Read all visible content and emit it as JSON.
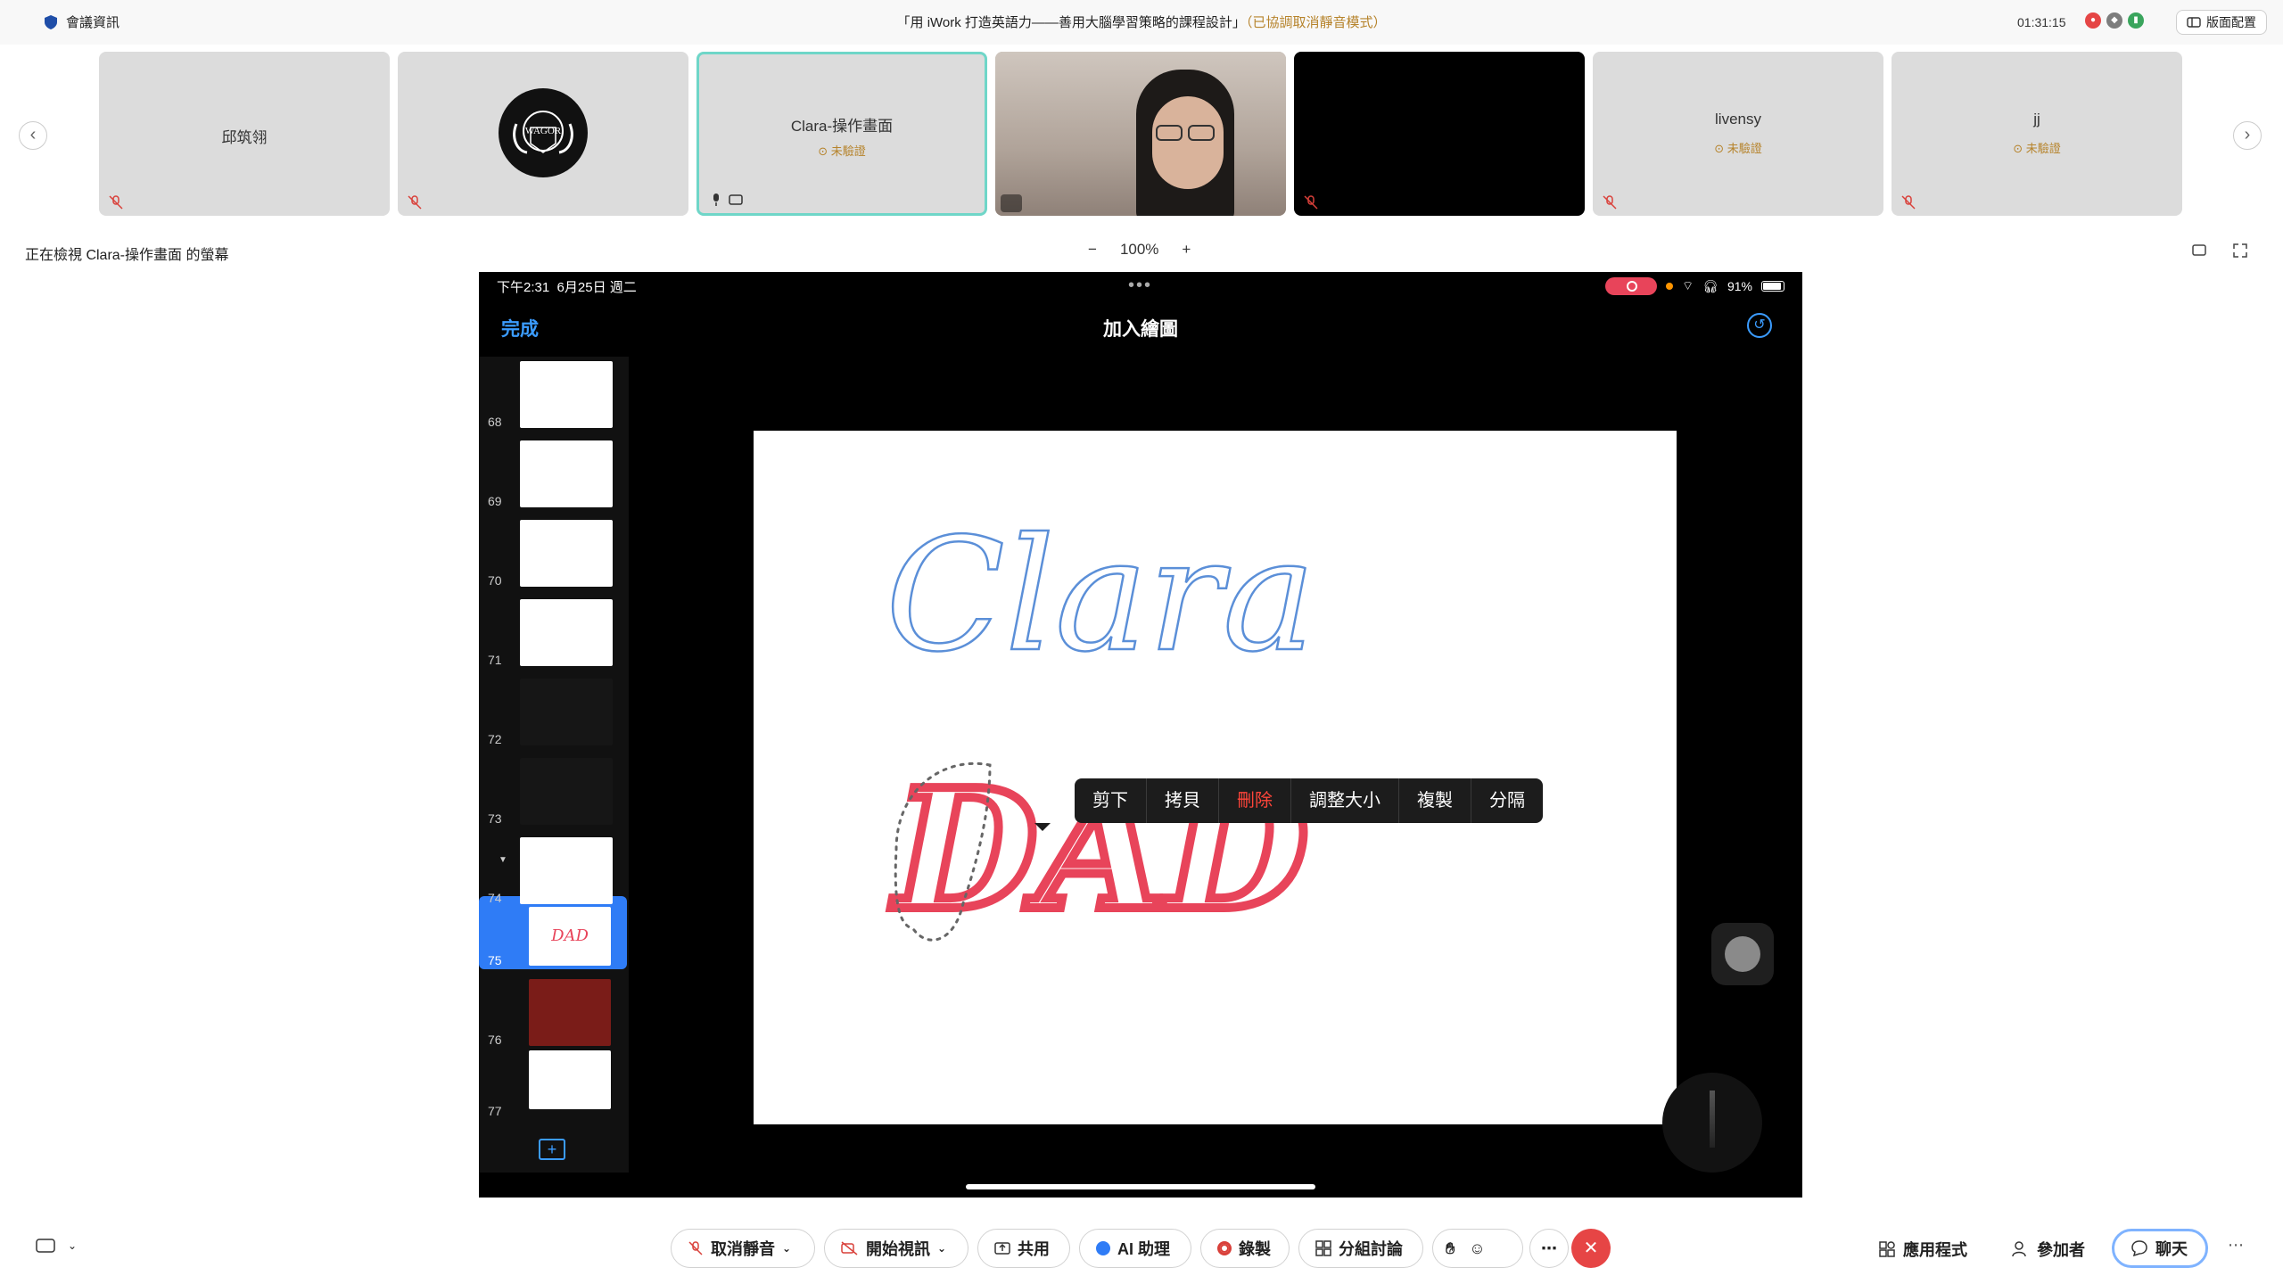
{
  "header": {
    "meeting_info": "會議資訊",
    "title": "「用 iWork 打造英語力——善用大腦學習策略的課程設計」",
    "title_note": "（已協調取消靜音模式）",
    "time": "01:31:15",
    "layout_label": "版面配置"
  },
  "participants": [
    {
      "name": "邱筑翎",
      "status": ""
    },
    {
      "name": "",
      "status": ""
    },
    {
      "name": "Clara-操作畫面",
      "status": "未驗證"
    },
    {
      "name": "",
      "status": ""
    },
    {
      "name": "",
      "status": ""
    },
    {
      "name": "livensy",
      "status": "未驗證"
    },
    {
      "name": "jj",
      "status": "未驗證"
    }
  ],
  "logo_text": "WAGOR",
  "viewing_label": "正在檢視 Clara-操作畫面 的螢幕",
  "zoom": {
    "minus": "−",
    "value": "100%",
    "plus": "+"
  },
  "ipad": {
    "status_time": "下午2:31",
    "status_date": "6月25日 週二",
    "battery": "91%",
    "done": "完成",
    "title": "加入繪圖",
    "thumb_numbers": [
      "68",
      "69",
      "70",
      "71",
      "72",
      "73",
      "74",
      "75",
      "76",
      "77"
    ],
    "selected_slide": "75",
    "thumb_75_text": "DAD",
    "context_menu": [
      "剪下",
      "拷貝",
      "刪除",
      "調整大小",
      "複製",
      "分隔"
    ],
    "drawing_text_1": "Clara",
    "drawing_text_2": "DAD"
  },
  "colors": {
    "accent": "#3b9cff",
    "red": "#e8445a",
    "delete": "#ff453a",
    "end_call": "#e64545"
  },
  "toolbar": {
    "unmute": "取消靜音",
    "start_video": "開始視訊",
    "share": "共用",
    "ai": "AI 助理",
    "record": "錄製",
    "breakout": "分組討論",
    "more": "⋯",
    "apps": "應用程式",
    "participants": "參加者",
    "chat": "聊天"
  }
}
